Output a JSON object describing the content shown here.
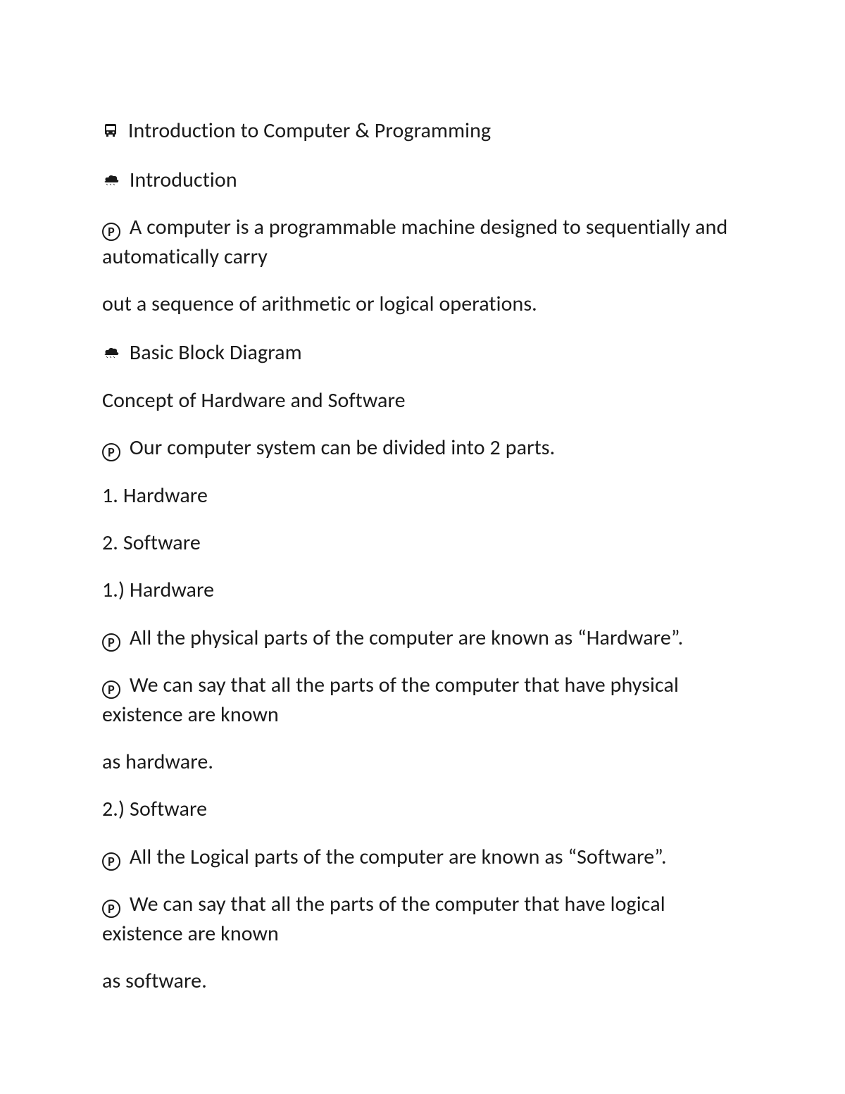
{
  "lines": {
    "l1": "Introduction to Computer & Programming",
    "l2": "Introduction",
    "l3": "A computer is a programmable machine designed to sequentially and automatically carry",
    "l4": "out a sequence of arithmetic or logical operations.",
    "l5": "Basic Block Diagram",
    "l6": "Concept of Hardware and Software",
    "l7": "Our computer system can be divided into 2 parts.",
    "l8": "1. Hardware",
    "l9": "2. Software",
    "l10": "1.) Hardware",
    "l11": "All the physical parts of the computer are known as “Hardware”.",
    "l12": "We can say that all the parts of the computer that have physical existence are known",
    "l13": "as hardware.",
    "l14": "2.) Software",
    "l15": "All the Logical parts of the computer are known as “Software”.",
    "l16": "We can say that all the parts of the computer that have logical existence are known",
    "l17": "as software."
  },
  "glyphs": {
    "p": "P"
  }
}
